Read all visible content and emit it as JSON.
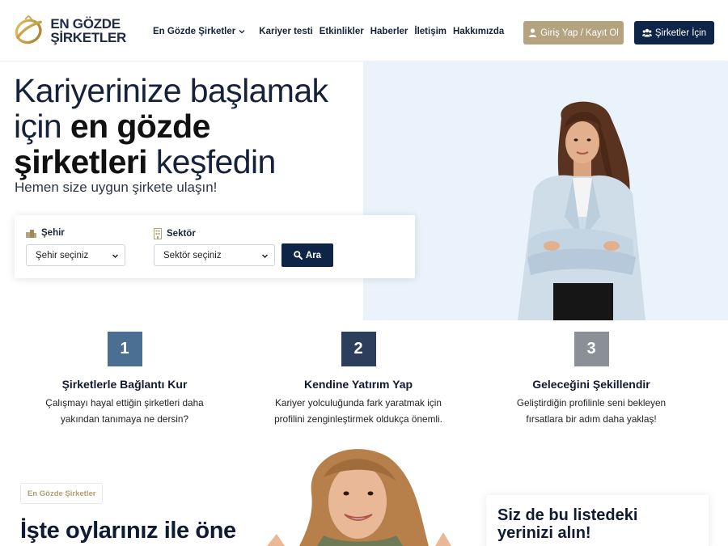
{
  "header": {
    "logo": {
      "line1": "EN GÖZDE",
      "line2": "ŞİRKETLER"
    },
    "nav": [
      "En Gözde Şirketler",
      "Kariyer testi",
      "Etkinlikler",
      "Haberler",
      "İletişim",
      "Hakkımızda"
    ],
    "login_label": "Giriş Yap / Kayıt Ol",
    "company_label": "Şirketler İçin"
  },
  "hero": {
    "title_line1": "Kariyerinize başlamak",
    "title_line2_light": "için ",
    "title_line2_bold": "en gözde",
    "title_line3_bold": "şirketleri",
    "title_line3_light": " keşfedin",
    "subtitle": "Hemen size uygun şirkete ulaşın!"
  },
  "search": {
    "city_label": "Şehir",
    "city_value": "Şehir seçiniz",
    "sector_label": "Sektör",
    "sector_value": "Sektör seçiniz",
    "button_label": "Ara"
  },
  "steps": [
    {
      "num": "1",
      "title": "Şirketlerle Bağlantı Kur",
      "line1": "Çalışmayı hayal ettiğin şirketleri daha",
      "line2": "yakından tanımaya ne dersin?",
      "color": "#4a6f92"
    },
    {
      "num": "2",
      "title": "Kendine Yatırım Yap",
      "line1": "Kariyer yolculuğunda fark yaratmak için",
      "line2": "profilini zenginleştirmek oldukça önemli.",
      "color": "#2c3e5c"
    },
    {
      "num": "3",
      "title": "Geleceğini Şekillendir",
      "line1": "Geliştirdiğin profilinle seni bekleyen",
      "line2": "fırsatlara bir adım daha yaklaş!",
      "color": "#8a9096"
    }
  ],
  "bottom": {
    "tag": "En Gözde Şirketler",
    "title": "İşte oylarınız ile öne",
    "cta_line1": "Siz de bu listedeki",
    "cta_line2": "yerinizi alın!"
  },
  "colors": {
    "navy": "#0f2547",
    "gold": "#b4a37f",
    "hero_bg": "#eaf3fb"
  }
}
